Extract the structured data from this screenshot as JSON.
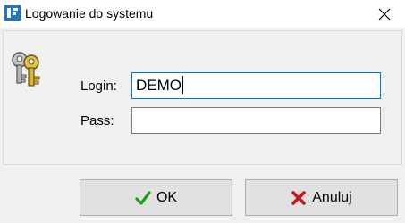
{
  "window": {
    "title": "Logowanie do systemu",
    "app_icon": "app-logo-icon",
    "close_icon": "close-icon"
  },
  "form": {
    "keys_icon": "keys-icon",
    "login_label": "Login:",
    "login_value": "DEMO",
    "pass_label": "Pass:",
    "pass_value": ""
  },
  "buttons": {
    "ok_label": "OK",
    "ok_icon": "checkmark-icon",
    "cancel_label": "Anuluj",
    "cancel_icon": "x-icon"
  },
  "colors": {
    "accent": "#0078d7",
    "ok_icon": "#1e9e1e",
    "cancel_icon": "#c4161c"
  }
}
